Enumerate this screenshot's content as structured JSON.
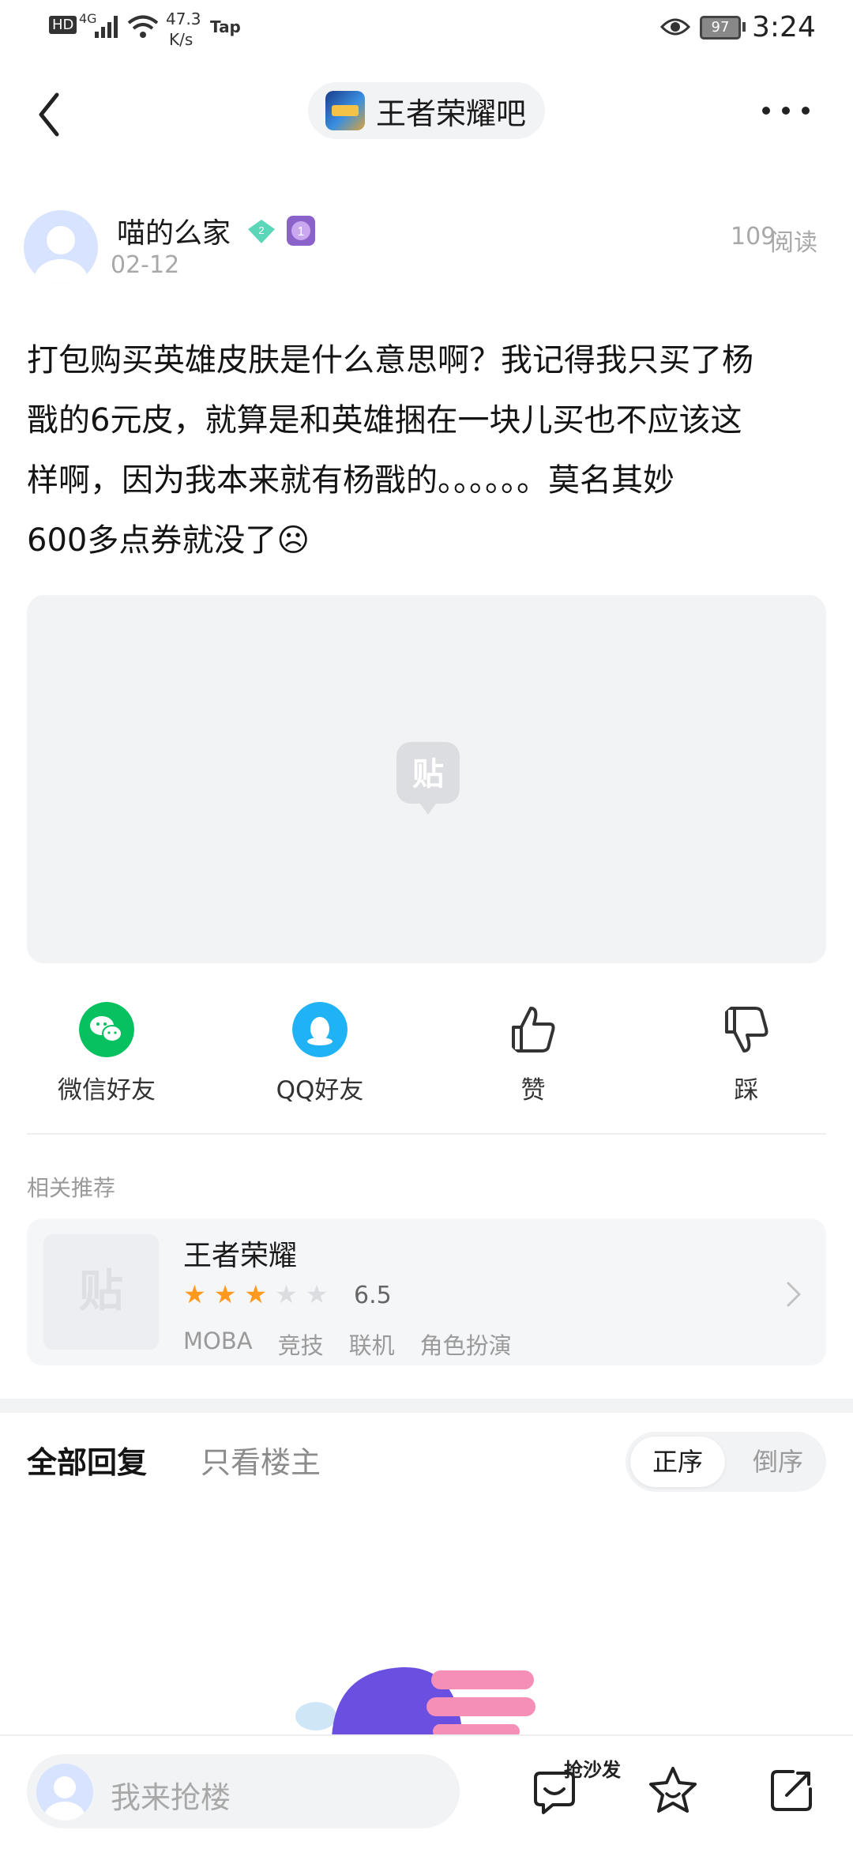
{
  "status_bar": {
    "hd": "HD",
    "network": "4G",
    "speed_value": "47.3",
    "speed_unit": "K/s",
    "tap_label": "Tap",
    "battery": "97",
    "time": "3:24"
  },
  "nav": {
    "forum_name": "王者荣耀吧"
  },
  "post": {
    "author": "喵的么家",
    "level_badge": "2",
    "rank_badge": "1",
    "date": "02-12",
    "read_count": "109",
    "read_label": "阅读",
    "content_lines": [
      "打包购买英雄皮肤是什么意思啊？我记得我只买了杨",
      "戬的6元皮，就算是和英雄捆在一块儿买也不应该这",
      "样啊，因为我本来就有杨戬的。。。。。。莫名其妙",
      "600多点券就没了☹"
    ],
    "image_placeholder": "贴"
  },
  "share": {
    "wechat_label": "微信好友",
    "qq_label": "QQ好友",
    "like_label": "赞",
    "dislike_label": "踩"
  },
  "recommend": {
    "section_title": "相关推荐",
    "thumb_glyph": "贴",
    "name": "王者荣耀",
    "rating": 6.5,
    "rating_text": "6.5",
    "stars_filled": 3,
    "stars_total": 5,
    "tags": [
      "MOBA",
      "竞技",
      "联机",
      "角色扮演"
    ]
  },
  "replies": {
    "tab_all": "全部回复",
    "tab_owner_only": "只看楼主",
    "sort_asc": "正序",
    "sort_desc": "倒序"
  },
  "bottom_bar": {
    "reply_placeholder": "我来抢楼",
    "sofa_label": "抢沙发"
  },
  "colors": {
    "wechat": "#07c160",
    "qq": "#1fb3f5",
    "star": "#ff9a1f",
    "accent_purple": "#6b4fe0"
  },
  "icons": [
    "back-icon",
    "more-icon",
    "eye-icon",
    "battery-icon",
    "wechat-icon",
    "qq-icon",
    "thumb-up-icon",
    "thumb-down-icon",
    "chevron-right-icon",
    "emoji-icon",
    "star-icon",
    "share-icon"
  ]
}
